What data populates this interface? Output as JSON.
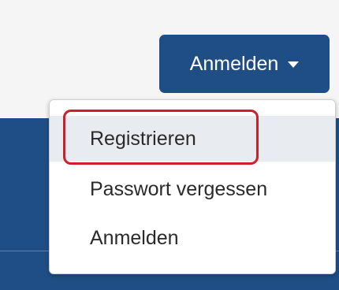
{
  "header": {
    "login_button_label": "Anmelden",
    "login_caret_icon": "caret-down-icon"
  },
  "dropdown": {
    "items": [
      {
        "label": "Registrieren",
        "highlighted": true
      },
      {
        "label": "Passwort vergessen",
        "highlighted": false
      },
      {
        "label": "Anmelden",
        "highlighted": false
      }
    ]
  },
  "colors": {
    "brand_blue": "#1f4e86",
    "highlight_red": "#cc1f2a",
    "active_item_bg": "#e8ebef"
  }
}
